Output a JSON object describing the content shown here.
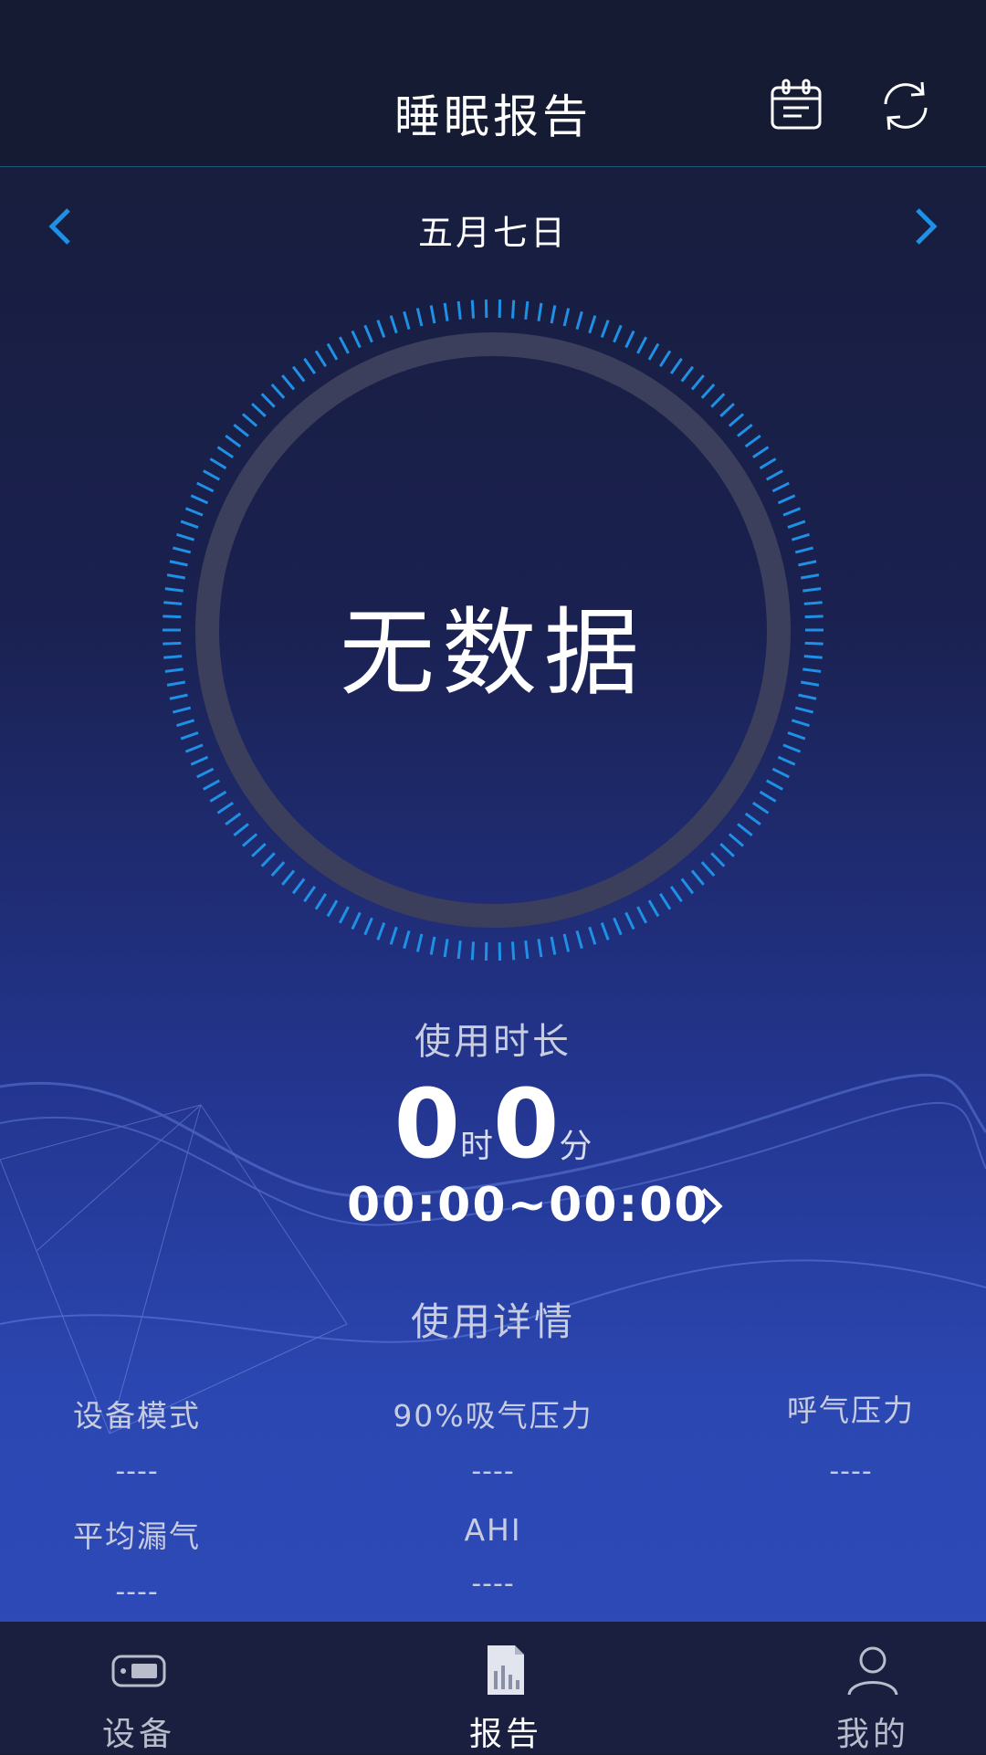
{
  "header": {
    "title": "睡眠报告",
    "calendar_icon": "calendar-icon",
    "refresh_icon": "refresh-icon"
  },
  "date_nav": {
    "date": "五月七日",
    "prev_icon": "chevron-left-icon",
    "next_icon": "chevron-right-icon"
  },
  "dial": {
    "text": "无数据"
  },
  "usage": {
    "label": "使用时长",
    "hours": "0",
    "hours_unit": "时",
    "minutes": "0",
    "minutes_unit": "分",
    "time_range": "00:00~00:00"
  },
  "details": {
    "title": "使用详情",
    "items": [
      {
        "label": "设备模式",
        "value": "----"
      },
      {
        "label": "90%吸气压力",
        "value": "----"
      },
      {
        "label": "呼气压力",
        "value": "----"
      },
      {
        "label": "平均漏气",
        "value": "----"
      },
      {
        "label": "AHI",
        "value": "----"
      }
    ]
  },
  "tabs": [
    {
      "label": "设备",
      "icon": "device-icon",
      "active": false
    },
    {
      "label": "报告",
      "icon": "report-icon",
      "active": true
    },
    {
      "label": "我的",
      "icon": "user-icon",
      "active": false
    }
  ],
  "colors": {
    "accent": "#1e90e6",
    "ring": "#3c3f5c",
    "tabbar": "#1a1f3f",
    "header": "#161b34"
  }
}
